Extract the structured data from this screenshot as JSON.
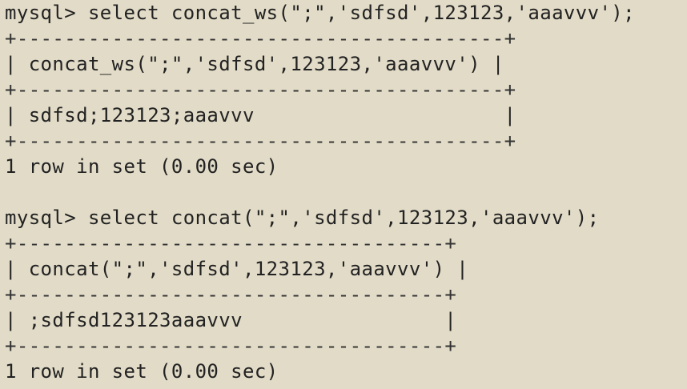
{
  "terminal": {
    "block1": {
      "prompt_command": "mysql> select concat_ws(\";\",'sdfsd',123123,'aaavvv');",
      "border_top": "+-----------------------------------------+",
      "header_row": "| concat_ws(\";\",'sdfsd',123123,'aaavvv') |",
      "border_mid": "+-----------------------------------------+",
      "data_row": "| sdfsd;123123;aaavvv                     |",
      "border_bottom": "+-----------------------------------------+",
      "status": "1 row in set (0.00 sec)"
    },
    "block2": {
      "prompt_command": "mysql> select concat(\";\",'sdfsd',123123,'aaavvv');",
      "border_top": "+------------------------------------+",
      "header_row": "| concat(\";\",'sdfsd',123123,'aaavvv') |",
      "border_mid": "+------------------------------------+",
      "data_row": "| ;sdfsd123123aaavvv                 |",
      "border_bottom": "+------------------------------------+",
      "status": "1 row in set (0.00 sec)"
    }
  },
  "colors": {
    "background": "#e1dbc7",
    "text": "#222222"
  }
}
